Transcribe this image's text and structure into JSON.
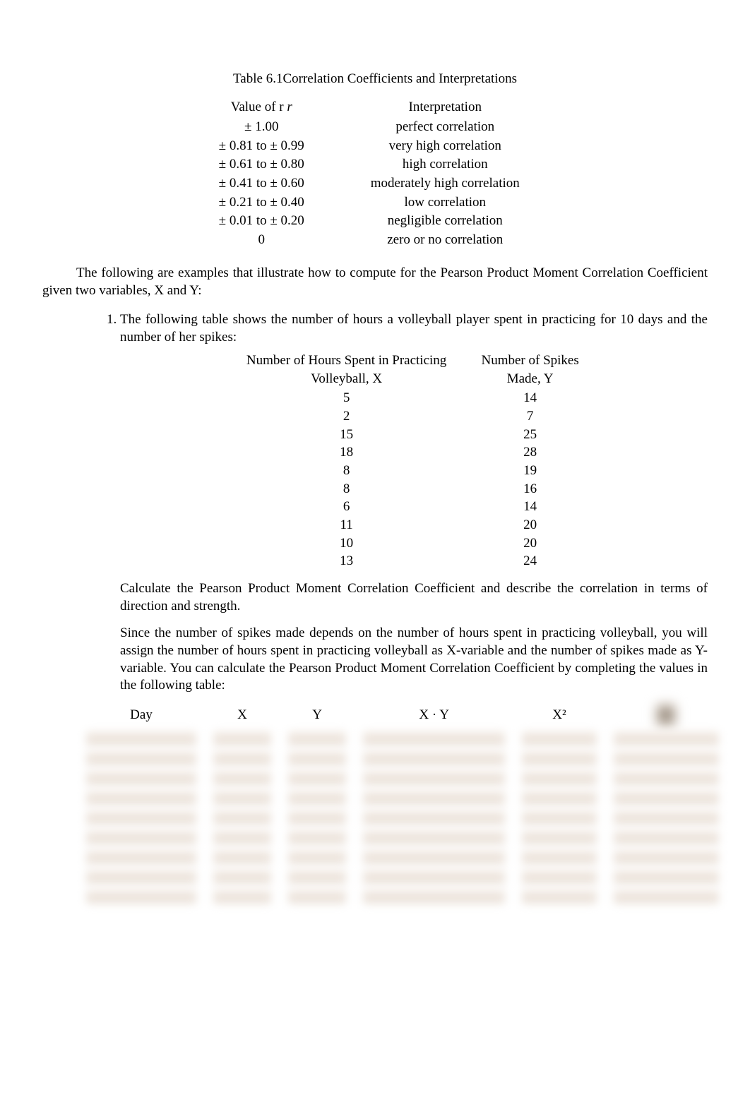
{
  "caption": "Table 6.1Correlation Coefficients and Interpretations",
  "t61": {
    "h1": "Value of r",
    "h2": "Interpretation",
    "rows": [
      {
        "v": "± 1.00",
        "i": "perfect correlation"
      },
      {
        "v": "± 0.81 to ± 0.99",
        "i": "very high correlation"
      },
      {
        "v": "± 0.61 to ± 0.80",
        "i": "high correlation"
      },
      {
        "v": "± 0.41 to ± 0.60",
        "i": "moderately high correlation"
      },
      {
        "v": "± 0.21 to ± 0.40",
        "i": "low correlation"
      },
      {
        "v": "± 0.01 to ± 0.20",
        "i": "negligible correlation"
      },
      {
        "v": "0",
        "i": "zero or no correlation"
      }
    ]
  },
  "p1a": "The following are examples that illustrate how to compute for the Pearson Product Moment Correlation Coefficient",
  "p1b": " given two variables, X and Y:",
  "item1_lead": "The following table shows the number of hours a volleyball player spent in practicing for 10 days and the number of her spikes:",
  "dt": {
    "h1": "Number of Hours Spent in Practicing Volleyball, X",
    "h2": "Number of Spikes Made, Y",
    "rows": [
      {
        "x": "5",
        "y": "14"
      },
      {
        "x": "2",
        "y": "7"
      },
      {
        "x": "15",
        "y": "25"
      },
      {
        "x": "18",
        "y": "28"
      },
      {
        "x": "8",
        "y": "19"
      },
      {
        "x": "8",
        "y": "16"
      },
      {
        "x": "6",
        "y": "14"
      },
      {
        "x": "11",
        "y": "20"
      },
      {
        "x": "10",
        "y": "20"
      },
      {
        "x": "13",
        "y": "24"
      }
    ]
  },
  "after1": "Calculate the Pearson Product Moment Correlation Coefficient and describe the correlation in terms of direction and strength.",
  "after2": "Since the number of spikes made depends on the number of hours spent in practicing volleyball, you will assign the number of hours spent in practicing volleyball as X-variable and the number of spikes made as Y-variable. You can calculate the Pearson Product Moment Correlation Coefficient by completing the values in the following table:",
  "wt": {
    "h": [
      "Day",
      "X",
      "Y",
      "X · Y",
      "X²",
      ""
    ]
  },
  "r_label": "r"
}
